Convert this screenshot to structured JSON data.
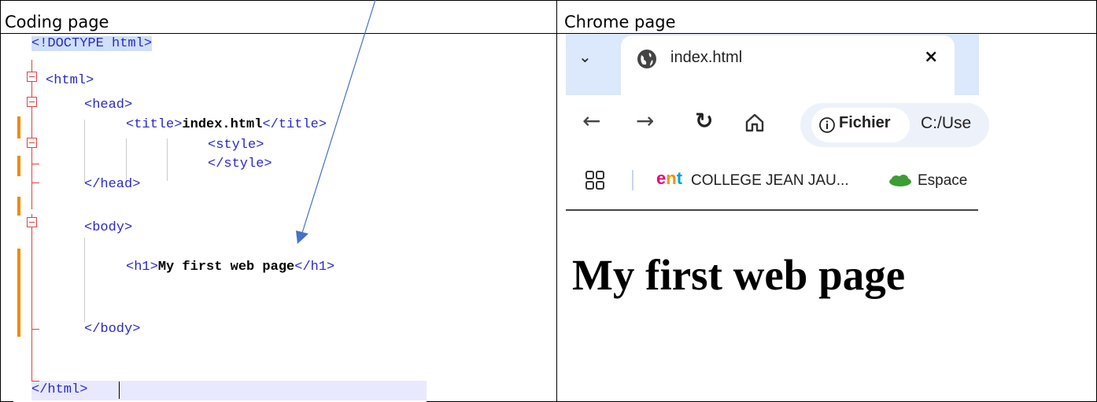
{
  "headers": {
    "left": "Coding page",
    "right": "Chrome page"
  },
  "code_lines": [
    "<!DOCTYPE html>",
    "<html>",
    "<head>",
    "<title>",
    "index.html",
    "</title>",
    "<style>",
    "</style>",
    "</head>",
    "<body>",
    "<h1>",
    "My first web page",
    "</h1>",
    "</body>",
    "</html>"
  ],
  "chrome": {
    "tab_title": "index.html",
    "security_label": "Fichier",
    "url": "C:/Use",
    "bookmarks": [
      "COLLEGE JEAN JAU...",
      "Espace"
    ],
    "page_heading": "My first web page"
  },
  "icons": [
    "chevron-down-icon",
    "globe-icon",
    "close-icon",
    "back-icon",
    "forward-icon",
    "reload-icon",
    "home-icon",
    "info-icon",
    "apps-icon",
    "ent-logo-icon",
    "cloud-icon"
  ],
  "colors": {
    "tag_blue": "#2929cc",
    "fold_red": "#dd4444",
    "change_orange": "#f08a00",
    "tabbar_bg": "#dce8fb"
  }
}
